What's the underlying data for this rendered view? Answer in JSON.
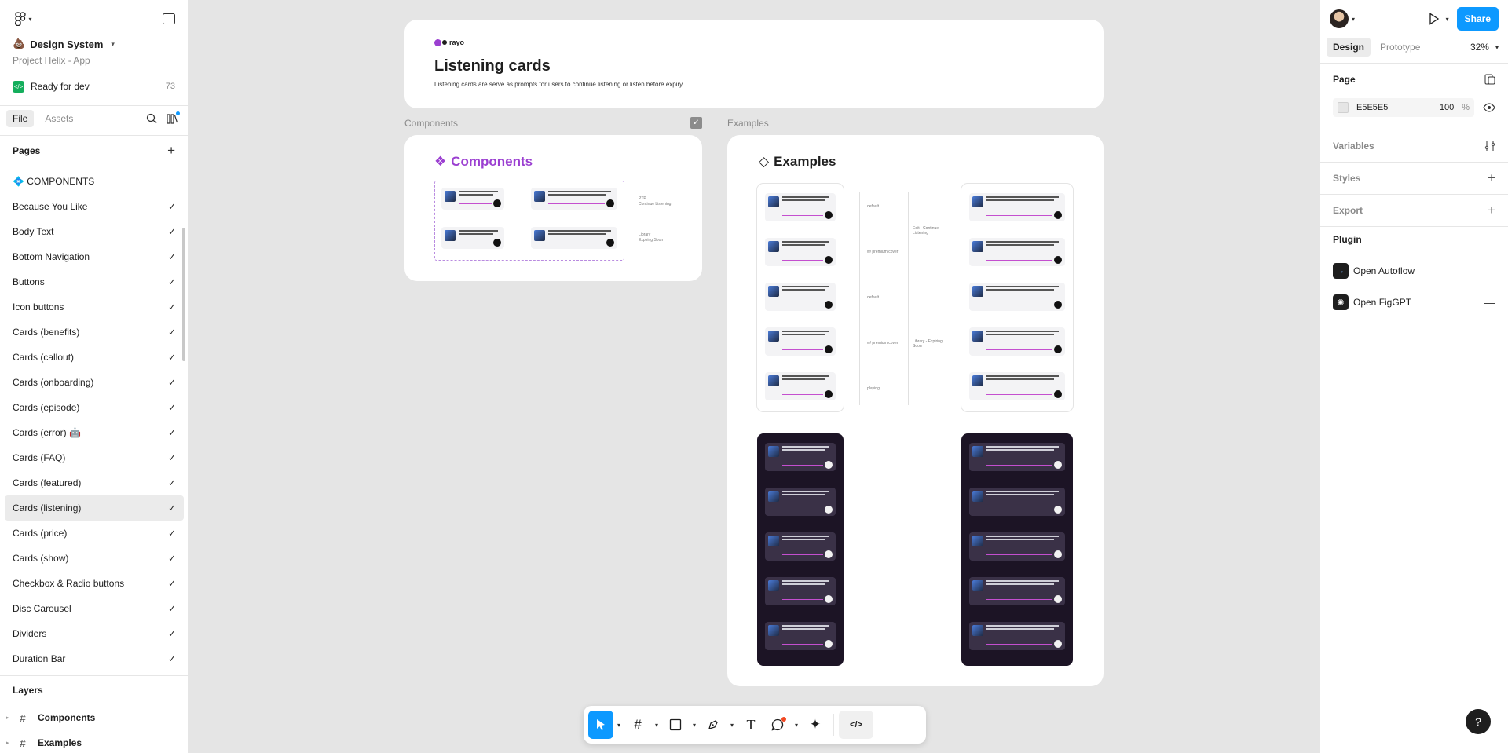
{
  "left": {
    "project_name": "Design System",
    "project_sub": "Project Helix - App",
    "ready_label": "Ready for dev",
    "ready_count": "73",
    "tabs": [
      "File",
      "Assets"
    ],
    "pages_header": "Pages",
    "pages": [
      {
        "label": "💠 COMPONENTS",
        "check": false
      },
      {
        "label": "Because You Like",
        "check": true
      },
      {
        "label": "Body Text",
        "check": true
      },
      {
        "label": "Bottom Navigation",
        "check": true
      },
      {
        "label": "Buttons",
        "check": true
      },
      {
        "label": "Icon buttons",
        "check": true
      },
      {
        "label": "Cards (benefits)",
        "check": true
      },
      {
        "label": "Cards (callout)",
        "check": true
      },
      {
        "label": "Cards (onboarding)",
        "check": true
      },
      {
        "label": "Cards (episode)",
        "check": true
      },
      {
        "label": "Cards (error) 🤖",
        "check": true
      },
      {
        "label": "Cards (FAQ)",
        "check": true
      },
      {
        "label": "Cards (featured)",
        "check": true
      },
      {
        "label": "Cards (listening)",
        "check": true,
        "active": true
      },
      {
        "label": "Cards (price)",
        "check": true
      },
      {
        "label": "Cards (show)",
        "check": true
      },
      {
        "label": "Checkbox & Radio buttons",
        "check": true
      },
      {
        "label": "Disc Carousel",
        "check": true
      },
      {
        "label": "Dividers",
        "check": true
      },
      {
        "label": "Duration Bar",
        "check": true
      }
    ],
    "check_glyph": "✓",
    "layers_header": "Layers",
    "layers": [
      "Components",
      "Examples"
    ]
  },
  "right": {
    "tabs": [
      "Design",
      "Prototype"
    ],
    "zoom": "32%",
    "share": "Share",
    "page_header": "Page",
    "page_color": "E5E5E5",
    "page_opacity": "100",
    "percent": "%",
    "variables": "Variables",
    "styles": "Styles",
    "export": "Export",
    "plugin_header": "Plugin",
    "plugins": [
      "Open Autoflow",
      "Open FigGPT"
    ]
  },
  "canvas": {
    "header_logo": "rayo",
    "header_title": "Listening cards",
    "header_desc": "Listening cards are serve as prompts for users to continue listening or listen before expiry.",
    "components_label": "Components",
    "examples_label": "Examples",
    "components_title": "Components",
    "examples_title": "Examples",
    "comp_tags": [
      "PTP",
      "Continue Listening",
      "Library",
      "Expiring Soon"
    ],
    "ex_tags": [
      "default",
      "w/ premium cover",
      "default",
      "w/ premium cover",
      "playing"
    ],
    "ex_group_tags": [
      "Edit - Continue Listening",
      "Library - Expiring Soon"
    ]
  },
  "colors": {
    "accent": "#0d99ff",
    "brand_purple": "#9b3fd1",
    "canvas_bg": "#e5e5e5",
    "dark_phone": "#1c1425"
  }
}
